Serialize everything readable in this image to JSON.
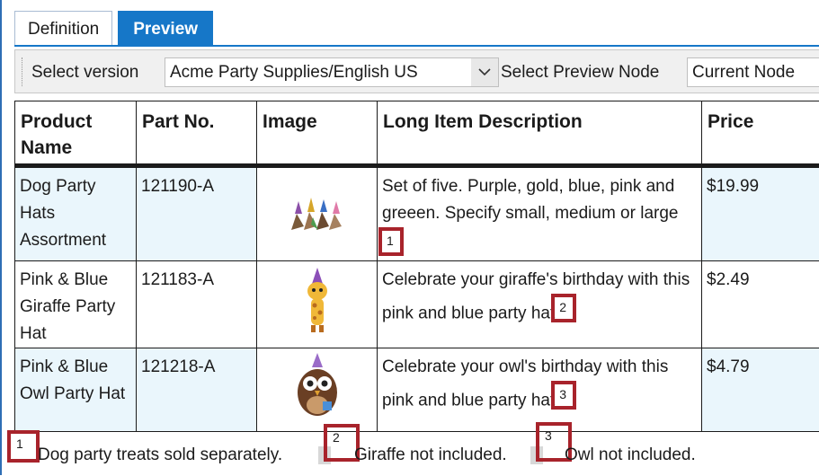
{
  "tabs": [
    {
      "label": "Definition",
      "active": false
    },
    {
      "label": "Preview",
      "active": true
    }
  ],
  "toolbar": {
    "version_label": "Select version",
    "version_value": "Acme Party Supplies/English US",
    "node_label": "Select Preview Node",
    "node_value": "Current Node"
  },
  "table": {
    "headers": [
      "Product Name",
      "Part No.",
      "Image",
      "Long Item Description",
      "Price"
    ],
    "rows": [
      {
        "name": "Dog Party Hats Assortment",
        "part": "121190-A",
        "image": "dogs-party-hats-image",
        "desc": "Set of five. Purple, gold, blue, pink and greeen. Specify small, medium or large",
        "note": "1",
        "price": "$19.99"
      },
      {
        "name": "Pink & Blue Giraffe Party Hat",
        "part": "121183-A",
        "image": "giraffe-party-hat-image",
        "desc": "Celebrate your giraffe's birthday with this pink and blue party hat",
        "note": "2",
        "price": "$2.49"
      },
      {
        "name": "Pink & Blue Owl Party Hat",
        "part": "121218-A",
        "image": "owl-party-hat-image",
        "desc": "Celebrate your owl's birthday with this pink and blue party hat",
        "note": "3",
        "price": "$4.79"
      }
    ]
  },
  "footnotes": [
    {
      "num": "1",
      "text": "Dog party treats sold separately."
    },
    {
      "num": "2",
      "text": "Giraffe not included."
    },
    {
      "num": "3",
      "text": "Owl not included."
    }
  ],
  "colors": {
    "accent": "#1677c8",
    "highlight": "#a8232b",
    "row_shade": "#eaf6fc"
  }
}
